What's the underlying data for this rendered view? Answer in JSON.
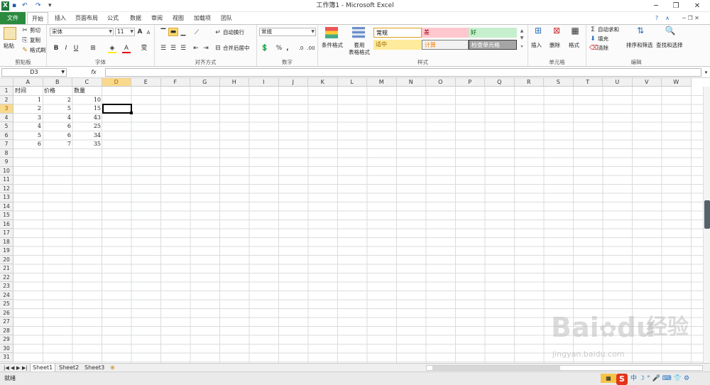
{
  "window": {
    "title": "工作簿1 - Microsoft Excel",
    "minimize": "─",
    "restore": "❐",
    "close": "✕"
  },
  "quick_access": {
    "app_icon": "X",
    "save": "▪",
    "undo": "↶",
    "redo": "↷",
    "customize": "▾"
  },
  "tabs": [
    "文件",
    "开始",
    "插入",
    "页面布局",
    "公式",
    "数据",
    "审阅",
    "视图",
    "加载项",
    "团队"
  ],
  "active_tab": "开始",
  "ribbon": {
    "clipboard": {
      "label": "剪贴板",
      "paste": "粘贴",
      "cut": "剪切",
      "copy": "复制",
      "format_painter": "格式刷"
    },
    "font": {
      "label": "字体",
      "font_name": "宋体",
      "font_size": "11",
      "grow": "A",
      "shrink": "A",
      "bold": "B",
      "italic": "I",
      "underline": "U",
      "wen": "变"
    },
    "alignment": {
      "label": "对齐方式",
      "wrap": "自动换行",
      "merge": "合并后居中"
    },
    "number": {
      "label": "数字",
      "format": "常规",
      "percent": "%",
      "comma": ","
    },
    "styles": {
      "label": "样式",
      "conditional": "条件格式",
      "table": "套用\n表格格式",
      "cells": [
        "常规",
        "差",
        "好",
        "适中",
        "计算",
        "检查单元格"
      ]
    },
    "cells": {
      "label": "单元格",
      "insert": "插入",
      "delete": "删除",
      "format": "格式"
    },
    "editing": {
      "label": "编辑",
      "autosum": "自动求和",
      "fill": "填充",
      "clear": "清除",
      "sort": "排序和筛选",
      "find": "查找和选择"
    }
  },
  "formula_bar": {
    "name_box": "D3",
    "fx": "fx",
    "value": ""
  },
  "columns": [
    "A",
    "B",
    "C",
    "D",
    "E",
    "F",
    "G",
    "H",
    "I",
    "J",
    "K",
    "L",
    "M",
    "N",
    "O",
    "P",
    "Q",
    "R",
    "S",
    "T",
    "U",
    "V",
    "W"
  ],
  "rows": [
    "1",
    "2",
    "3",
    "4",
    "5",
    "6",
    "7",
    "8",
    "9",
    "10",
    "11",
    "12",
    "13",
    "14",
    "15",
    "16",
    "17",
    "18",
    "19",
    "20",
    "21",
    "22",
    "23",
    "24",
    "25",
    "26",
    "27",
    "28",
    "29",
    "30",
    "31"
  ],
  "cells": {
    "header": [
      "时间",
      "价格",
      "数量"
    ],
    "data": [
      [
        "1",
        "2",
        "10"
      ],
      [
        "2",
        "5",
        "15"
      ],
      [
        "3",
        "4",
        "43"
      ],
      [
        "4",
        "6",
        "25"
      ],
      [
        "5",
        "6",
        "34"
      ],
      [
        "6",
        "7",
        "35"
      ]
    ]
  },
  "selected_cell": "D3",
  "sheets": [
    "Sheet1",
    "Sheet2",
    "Sheet3"
  ],
  "status": {
    "ready": "就绪"
  },
  "watermark": {
    "brand": "Bai",
    "brand2": "du",
    "cn": "经验",
    "url": "jingyan.baidu.com"
  }
}
